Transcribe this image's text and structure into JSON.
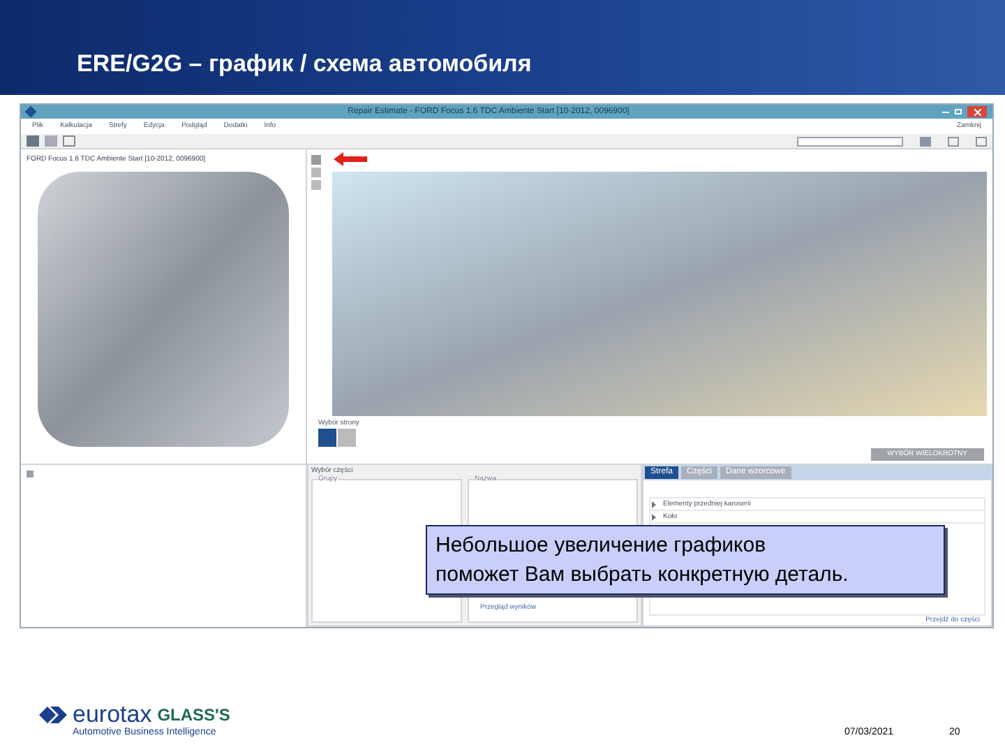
{
  "slide": {
    "title": "ERE/G2G – график / схема автомобиля",
    "date": "07/03/2021",
    "page": "20"
  },
  "logo": {
    "brand": "eurotax",
    "brand2": "GLASS'S",
    "tagline": "Automotive Business Intelligence"
  },
  "window": {
    "title": "Repair Estimate - FORD Focus 1.6 TDC Ambiente Start [10-2012, 0096900]",
    "close_label": "Zamknij"
  },
  "menu": [
    "Plik",
    "Kalkulacja",
    "Strefy",
    "Edycja",
    "Podgląd",
    "Dodatki",
    "Info"
  ],
  "vehicle": {
    "label": "FORD Focus 1.6 TDC Ambiente Start [10-2012, 0096900]"
  },
  "graphic": {
    "page_label": "Wybór strony",
    "multi_button": "WYBÓR WIELOKROTNY"
  },
  "lower": {
    "panel_title": "Wybór części",
    "group_1": "Grupy",
    "group_2": "Nazwa",
    "link": "Przegląd wyników"
  },
  "tabs": [
    {
      "label": "Strefa",
      "selected": true
    },
    {
      "label": "Części",
      "selected": false
    },
    {
      "label": "Dane wzorcowe",
      "selected": false
    }
  ],
  "tree": [
    {
      "label": "Elementy przedniej karoserii",
      "expanded": false
    },
    {
      "label": "Koło",
      "expanded": false
    }
  ],
  "tree_link": "Przejdź do części",
  "callout": {
    "lines": [
      "Небольшое увеличение графиков",
      "поможет Вам выбрать конкретную деталь."
    ]
  }
}
